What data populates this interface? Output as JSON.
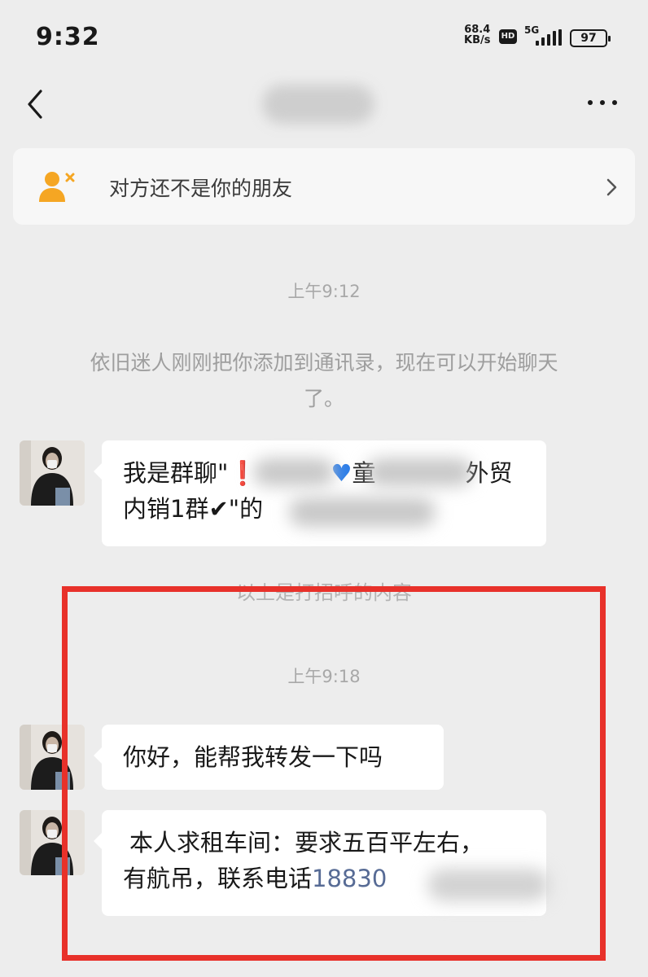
{
  "status_bar": {
    "time": "9:32",
    "net_speed": "68.4",
    "net_unit": "KB/s",
    "hd": "HD",
    "network": "5G",
    "battery": "97"
  },
  "banner": {
    "text": "对方还不是你的朋友",
    "icon": "person-add-icon"
  },
  "chat": {
    "timestamp_1": "上午9:12",
    "system_line_1": "依旧迷人刚刚把你添加到通讯录，现在可以开始聊天",
    "system_line_2": "了。",
    "greeting_line_1_a": "我是群聊\"",
    "greeting_line_1_b": "童",
    "greeting_line_1_c": "外贸",
    "greeting_line_2_a": "内销1群✔\"的",
    "greeting_note": "以上是打招呼的内容",
    "timestamp_2": "上午9:18",
    "msg_1": "你好，能帮我转发一下吗",
    "msg_2_line_1": "本人求租车间：要求五百平左右，",
    "msg_2_line_2": "有航吊，联系电话",
    "msg_2_phone": "18830"
  },
  "colors": {
    "background": "#ededed",
    "bubble": "#ffffff",
    "highlight_box": "#e8312a",
    "link": "#576b95",
    "banner_icon": "#f5a623"
  }
}
